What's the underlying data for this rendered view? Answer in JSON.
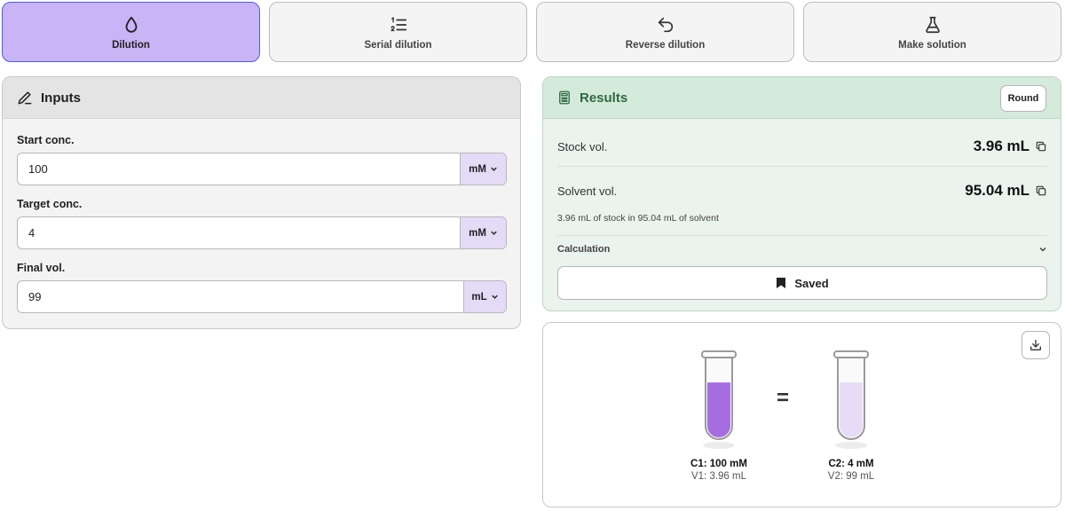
{
  "tabs": [
    {
      "label": "Dilution",
      "icon": "droplet-icon",
      "active": true
    },
    {
      "label": "Serial dilution",
      "icon": "numbered-list-icon",
      "active": false
    },
    {
      "label": "Reverse dilution",
      "icon": "undo-arrow-icon",
      "active": false
    },
    {
      "label": "Make solution",
      "icon": "flask-icon",
      "active": false
    }
  ],
  "inputs": {
    "title": "Inputs",
    "start_conc": {
      "label": "Start conc.",
      "value": "100",
      "unit": "mM"
    },
    "target_conc": {
      "label": "Target conc.",
      "value": "4",
      "unit": "mM"
    },
    "final_vol": {
      "label": "Final vol.",
      "value": "99",
      "unit": "mL"
    }
  },
  "results": {
    "title": "Results",
    "round_label": "Round",
    "stock_vol": {
      "label": "Stock vol.",
      "value": "3.96 mL"
    },
    "solvent_vol": {
      "label": "Solvent vol.",
      "value": "95.04 mL"
    },
    "summary": "3.96 mL of stock in 95.04 mL of solvent",
    "calculation_label": "Calculation",
    "saved_label": "Saved"
  },
  "visual": {
    "tube1": {
      "conc": "C1: 100 mM",
      "vol": "V1: 3.96 mL",
      "fill_fraction": 0.68
    },
    "equals": "=",
    "tube2": {
      "conc": "C2: 4 mM",
      "vol": "V2: 99 mL",
      "fill_fraction": 0.68
    }
  },
  "colors": {
    "active_tab": "#c9b4f6",
    "active_tab_border": "#4c5fe6",
    "results_header": "#d4eadb",
    "results_title": "#2d6a41",
    "unit_bg": "#e4dbf7",
    "tube1_liquid": "#a66ee0",
    "tube2_liquid": "#e6dcf6"
  }
}
